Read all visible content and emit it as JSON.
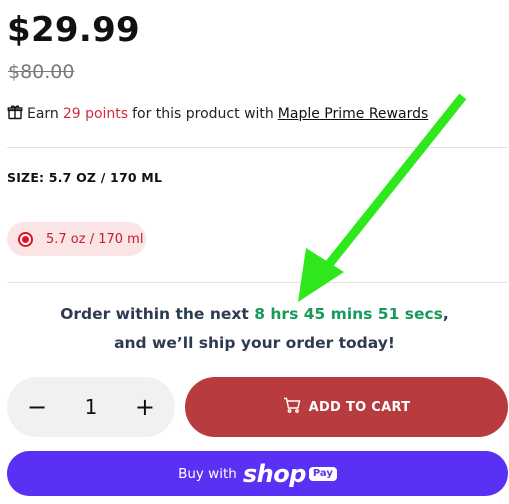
{
  "product": {
    "price": "$29.99",
    "compare_price": "$80.00"
  },
  "rewards": {
    "prefix": "Earn",
    "points": "29 points",
    "middle": "for this product with",
    "link": "Maple Prime Rewards",
    "icon": "gift-icon"
  },
  "size": {
    "label": "SIZE: 5.7 OZ / 170 ML",
    "option": "5.7 oz / 170 ml"
  },
  "shipping": {
    "prefix": "Order within the next",
    "timer": "8 hrs 45 mins 51 secs",
    "suffix": ",",
    "line2": "and we’ll ship your order today!"
  },
  "quantity": {
    "minus": "−",
    "value": "1",
    "plus": "+"
  },
  "cart": {
    "label": "ADD TO CART",
    "icon": "cart-icon"
  },
  "shop_pay": {
    "buy_with": "Buy with",
    "shop": "shop",
    "pay": "Pay"
  },
  "colors": {
    "points": "#d6293e",
    "timer": "#189a5b",
    "add_to_cart": "#b83b3f",
    "shop_pay": "#5a31f4",
    "arrow": "#2ee81c"
  }
}
